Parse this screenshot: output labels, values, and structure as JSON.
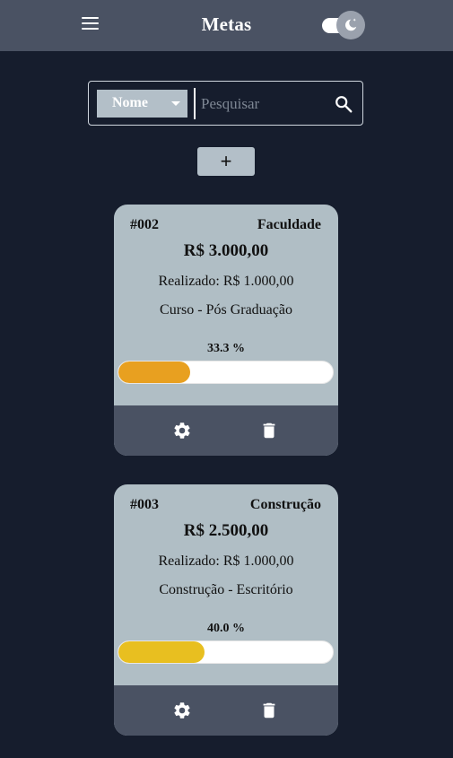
{
  "header": {
    "title": "Metas",
    "menu_icon": "menu-icon",
    "theme_toggle_icon": "moon-icon"
  },
  "search": {
    "filter_selected": "Nome",
    "placeholder": "Pesquisar",
    "value": "",
    "icon": "search-icon"
  },
  "add_button": {
    "label": "+"
  },
  "goals": [
    {
      "code": "#002",
      "category": "Faculdade",
      "amount": "R$ 3.000,00",
      "realized": "Realizado: R$ 1.000,00",
      "description": "Curso - Pós Graduação",
      "percent_label": "33.3 %",
      "progress": 0.333,
      "bar_color": "#e8a020"
    },
    {
      "code": "#003",
      "category": "Construção",
      "amount": "R$ 2.500,00",
      "realized": "Realizado: R$ 1.000,00",
      "description": "Construção - Escritório",
      "percent_label": "40.0 %",
      "progress": 0.4,
      "bar_color": "#e8bf20"
    }
  ],
  "colors": {
    "background": "#161d2d",
    "topbar": "#4a5263",
    "card": "#b0bec5",
    "card_actions": "#4a5263",
    "button": "#b3bfc8"
  }
}
